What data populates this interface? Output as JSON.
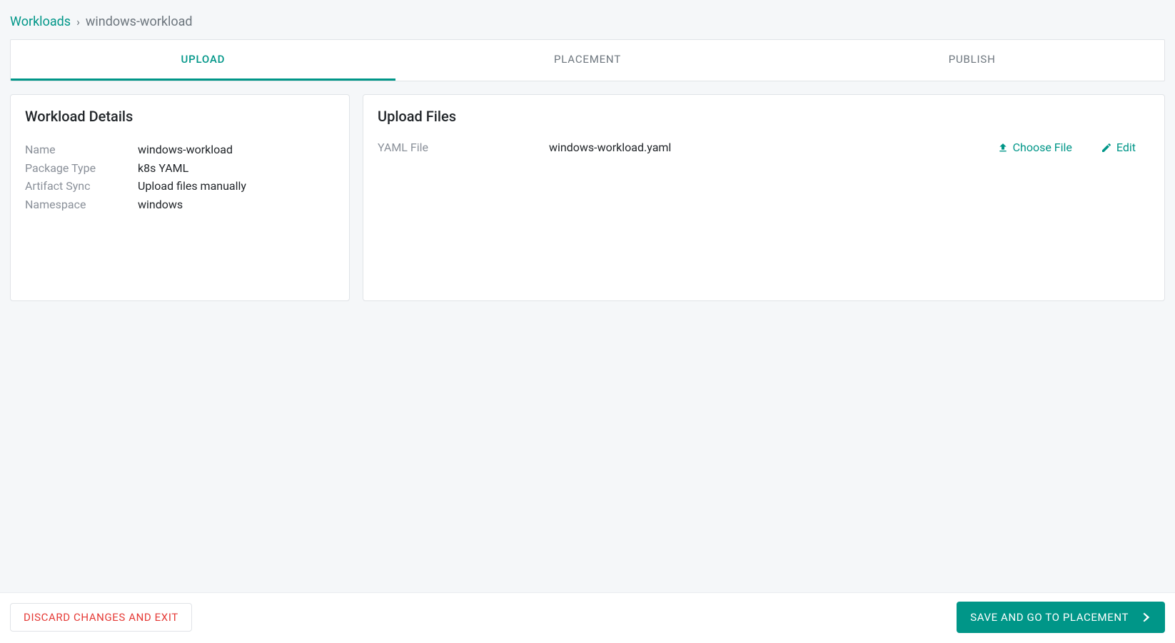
{
  "breadcrumb": {
    "root": "Workloads",
    "separator": "›",
    "current": "windows-workload"
  },
  "tabs": {
    "upload": "UPLOAD",
    "placement": "PLACEMENT",
    "publish": "PUBLISH"
  },
  "details": {
    "title": "Workload Details",
    "fields": {
      "name_label": "Name",
      "name_value": "windows-workload",
      "package_type_label": "Package Type",
      "package_type_value": "k8s YAML",
      "artifact_sync_label": "Artifact Sync",
      "artifact_sync_value": "Upload files manually",
      "namespace_label": "Namespace",
      "namespace_value": "windows"
    }
  },
  "upload": {
    "title": "Upload Files",
    "yaml_label": "YAML File",
    "yaml_filename": "windows-workload.yaml",
    "choose_file_label": "Choose File",
    "edit_label": "Edit"
  },
  "footer": {
    "discard_label": "DISCARD CHANGES AND EXIT",
    "save_label": "SAVE AND GO TO PLACEMENT"
  }
}
